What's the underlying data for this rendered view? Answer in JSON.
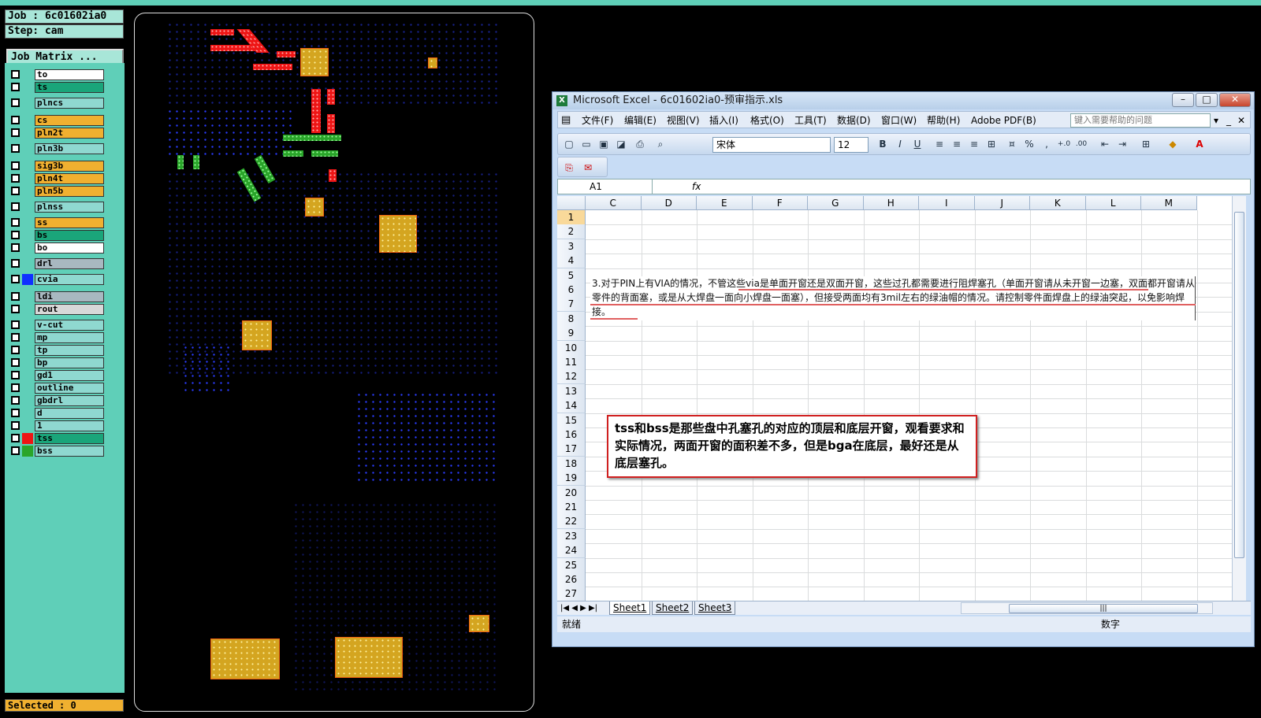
{
  "cam": {
    "job_label": "Job : 6c01602ia0",
    "step_label": "Step: cam",
    "matrix_button": "Job Matrix ...",
    "selected_label": "Selected : 0",
    "layers": [
      {
        "name": "to",
        "color": "#ffffff"
      },
      {
        "name": "ts",
        "color": "#1aa57a"
      },
      {
        "name": "plncs",
        "color": "#8fd8d0"
      },
      {
        "name": "cs",
        "color": "#f0b030"
      },
      {
        "name": "pln2t",
        "color": "#f0b030"
      },
      {
        "name": "pln3b",
        "color": "#8fd8d0"
      },
      {
        "name": "sig3b",
        "color": "#f0b030"
      },
      {
        "name": "pln4t",
        "color": "#f0b030"
      },
      {
        "name": "pln5b",
        "color": "#f0b030"
      },
      {
        "name": "plnss",
        "color": "#8fd8d0"
      },
      {
        "name": "ss",
        "color": "#f0b030"
      },
      {
        "name": "bs",
        "color": "#1aa57a"
      },
      {
        "name": "bo",
        "color": "#ffffff"
      },
      {
        "name": "drl",
        "color": "#a8b8c0"
      },
      {
        "name": "cvia",
        "color": "#8fd8d0"
      },
      {
        "name": "ldi",
        "color": "#a8b8c0"
      },
      {
        "name": "rout",
        "color": "#d8d8d8"
      },
      {
        "name": "v-cut",
        "color": "#8fd8d0"
      },
      {
        "name": "mp",
        "color": "#8fd8d0"
      },
      {
        "name": "tp",
        "color": "#8fd8d0"
      },
      {
        "name": "bp",
        "color": "#8fd8d0"
      },
      {
        "name": "gd1",
        "color": "#8fd8d0"
      },
      {
        "name": "outline",
        "color": "#8fd8d0"
      },
      {
        "name": "gbdrl",
        "color": "#8fd8d0"
      },
      {
        "name": "d",
        "color": "#8fd8d0"
      },
      {
        "name": "1",
        "color": "#8fd8d0"
      },
      {
        "name": "tss",
        "color": "#1aa57a"
      },
      {
        "name": "bss",
        "color": "#8fd8d0"
      }
    ]
  },
  "excel": {
    "title": "Microsoft Excel - 6c01602ia0-预审指示.xls",
    "menus": [
      "文件(F)",
      "编辑(E)",
      "视图(V)",
      "插入(I)",
      "格式(O)",
      "工具(T)",
      "数据(D)",
      "窗口(W)",
      "帮助(H)",
      "Adobe PDF(B)"
    ],
    "help_placeholder": "键入需要帮助的问题",
    "font_name": "宋体",
    "font_size": "12",
    "name_box": "A1",
    "fx_label": "fx",
    "columns": [
      "C",
      "D",
      "E",
      "F",
      "G",
      "H",
      "I",
      "J",
      "K",
      "L",
      "M"
    ],
    "rows": [
      "1",
      "2",
      "3",
      "4",
      "5",
      "6",
      "7",
      "8",
      "9",
      "10",
      "11",
      "12",
      "13",
      "14",
      "15",
      "16",
      "17",
      "18",
      "19",
      "20",
      "21",
      "22",
      "23",
      "24",
      "25",
      "26",
      "27"
    ],
    "cell_text": "3.对于PIN上有VIA的情况，不管这些via是单面开窗还是双面开窗，这些过孔都需要进行阻焊塞孔（单面开窗请从未开窗一边塞，双面都开窗请从零件的背面塞，或是从大焊盘一面向小焊盘一面塞），但接受两面均有3mil左右的绿油帽的情况。请控制零件面焊盘上的绿油突起，以免影响焊接。",
    "sheets": [
      "Sheet1",
      "Sheet2",
      "Sheet3"
    ],
    "status_left": "就绪",
    "status_right": "数字",
    "callout_text": "tss和bss是那些盘中孔塞孔的对应的顶层和底层开窗，观看要求和实际情况，两面开窗的面积差不多，但是bga在底层，最好还是从底层塞孔。"
  }
}
